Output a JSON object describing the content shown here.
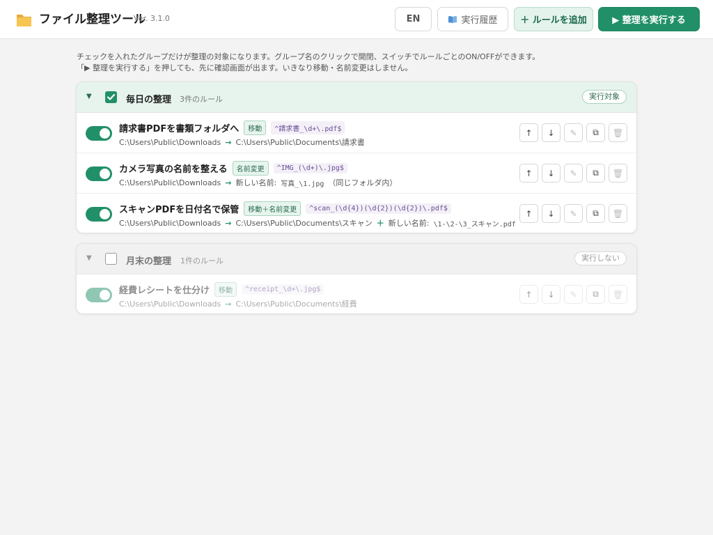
{
  "header": {
    "title": "ファイル整理ツール",
    "version": "Ver. 3.1.0",
    "lang_label": "EN",
    "history_label": "実行履歴",
    "add_rule_label": "＋ ルールを追加",
    "run_label": "▶ 整理を実行する"
  },
  "intro": {
    "line1": "チェックを入れたグループだけが整理の対象になります。グループ名のクリックで開閉、スイッチでルールごとのON/OFFができます。",
    "line2": "「▶ 整理を実行する」を押しても、先に確認画面が出ます。いきなり移動・名前変更はしません。"
  },
  "groups": [
    {
      "caret": "▼",
      "name": "毎日の整理",
      "count": "3件のルール",
      "badge": "実行対象",
      "checked": true,
      "rules": [
        {
          "name": "請求書PDFを書類フォルダへ",
          "tag": "移動",
          "regex": "^請求書_\\d+\\.pdf$",
          "source": "C:\\Users\\Public\\Downloads",
          "arrow": "→",
          "dest": "C:\\Users\\Public\\Documents\\請求書"
        },
        {
          "name": "カメラ写真の名前を整える",
          "tag": "名前変更",
          "regex": "^IMG_(\\d+)\\.jpg$",
          "source": "C:\\Users\\Public\\Downloads",
          "arrow": "→",
          "dest_label": "新しい名前:",
          "dest_mono": "写真_\\1.jpg",
          "dest_note": "（同じフォルダ内）"
        },
        {
          "name": "スキャンPDFを日付名で保管",
          "tag": "移動＋名前変更",
          "regex": "^scan_(\\d{4})(\\d{2})(\\d{2})\\.pdf$",
          "source": "C:\\Users\\Public\\Downloads",
          "arrow": "→",
          "dest": "C:\\Users\\Public\\Documents\\スキャン",
          "plus": "＋",
          "rename_label": "新しい名前:",
          "rename_mono": "\\1-\\2-\\3_スキャン.pdf"
        }
      ]
    },
    {
      "caret": "▼",
      "name": "月末の整理",
      "count": "1件のルール",
      "badge": "実行しない",
      "checked": false,
      "rules": [
        {
          "name": "経費レシートを仕分け",
          "tag": "移動",
          "regex": "^receipt_\\d+\\.jpg$",
          "source": "C:\\Users\\Public\\Downloads",
          "arrow": "→",
          "dest": "C:\\Users\\Public\\Documents\\経費"
        }
      ]
    }
  ],
  "icons": {
    "logo": "folder-icon",
    "history": "book-icon",
    "up": "↑",
    "down": "↓",
    "edit": "✎",
    "copy": "⧉",
    "delete": "🗑"
  },
  "colors": {
    "accent": "#219068",
    "accent_light": "#e6f4ed",
    "regex_bg": "#f3f0f7",
    "regex_text": "#6a4c93"
  }
}
